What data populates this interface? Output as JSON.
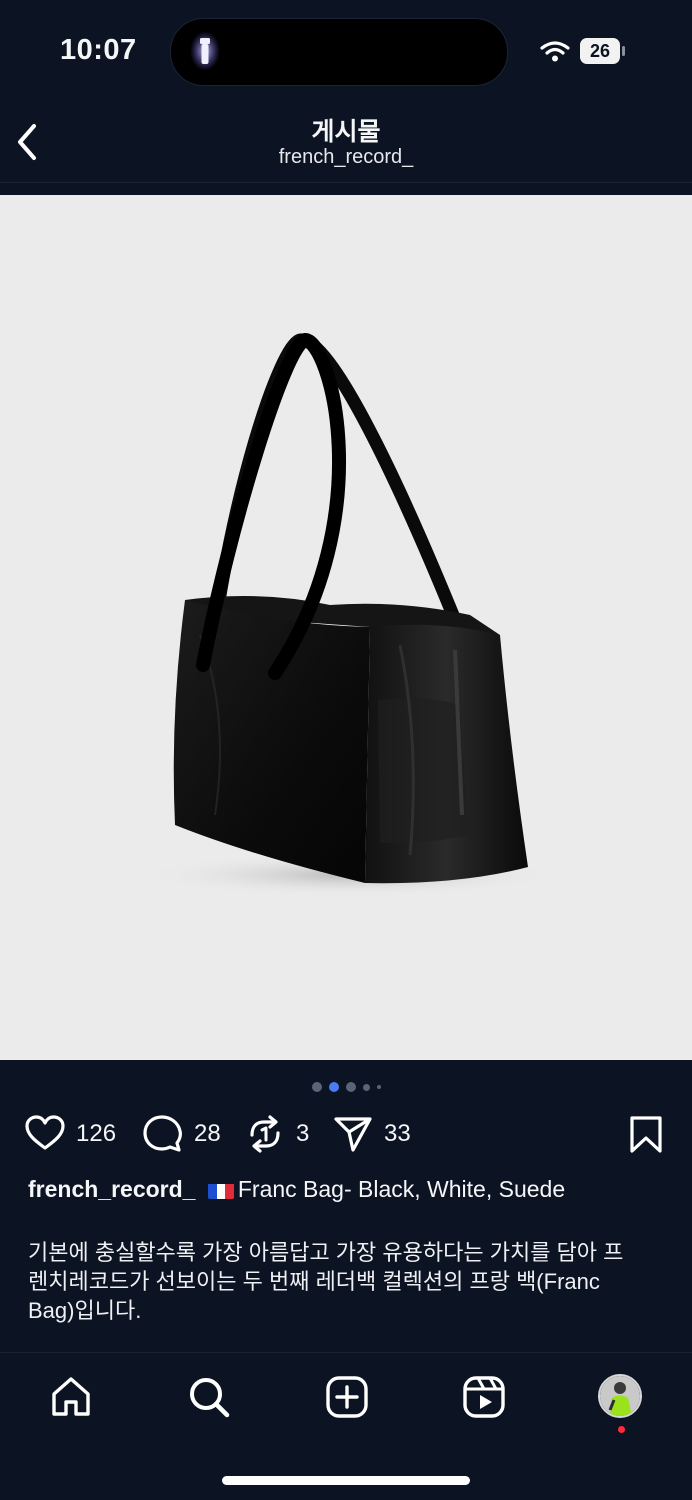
{
  "status_bar": {
    "time": "10:07",
    "battery": "26"
  },
  "header": {
    "title": "게시물",
    "subtitle": "french_record_"
  },
  "carousel": {
    "count": 5,
    "active_index": 1
  },
  "actions": {
    "likes": "126",
    "comments": "28",
    "reposts": "3",
    "shares": "33"
  },
  "caption": {
    "username": "french_record_",
    "title": "Franc Bag- Black, White, Suede",
    "body_lines": [
      "기본에 충실할수록 가장 아름답고 가장 유용하다는 가치를 담아 프",
      "렌치레코드가 선보이는 두 번째 레더백 컬렉션의 프랑 백(Franc",
      "Bag)입니다."
    ]
  },
  "tab_bar": [
    "home-icon",
    "search-icon",
    "create-icon",
    "reels-icon",
    "profile-avatar"
  ],
  "colors": {
    "background": "#0c1322",
    "accent_dot": "#4a7cf5",
    "notification": "#ff2b3c"
  }
}
